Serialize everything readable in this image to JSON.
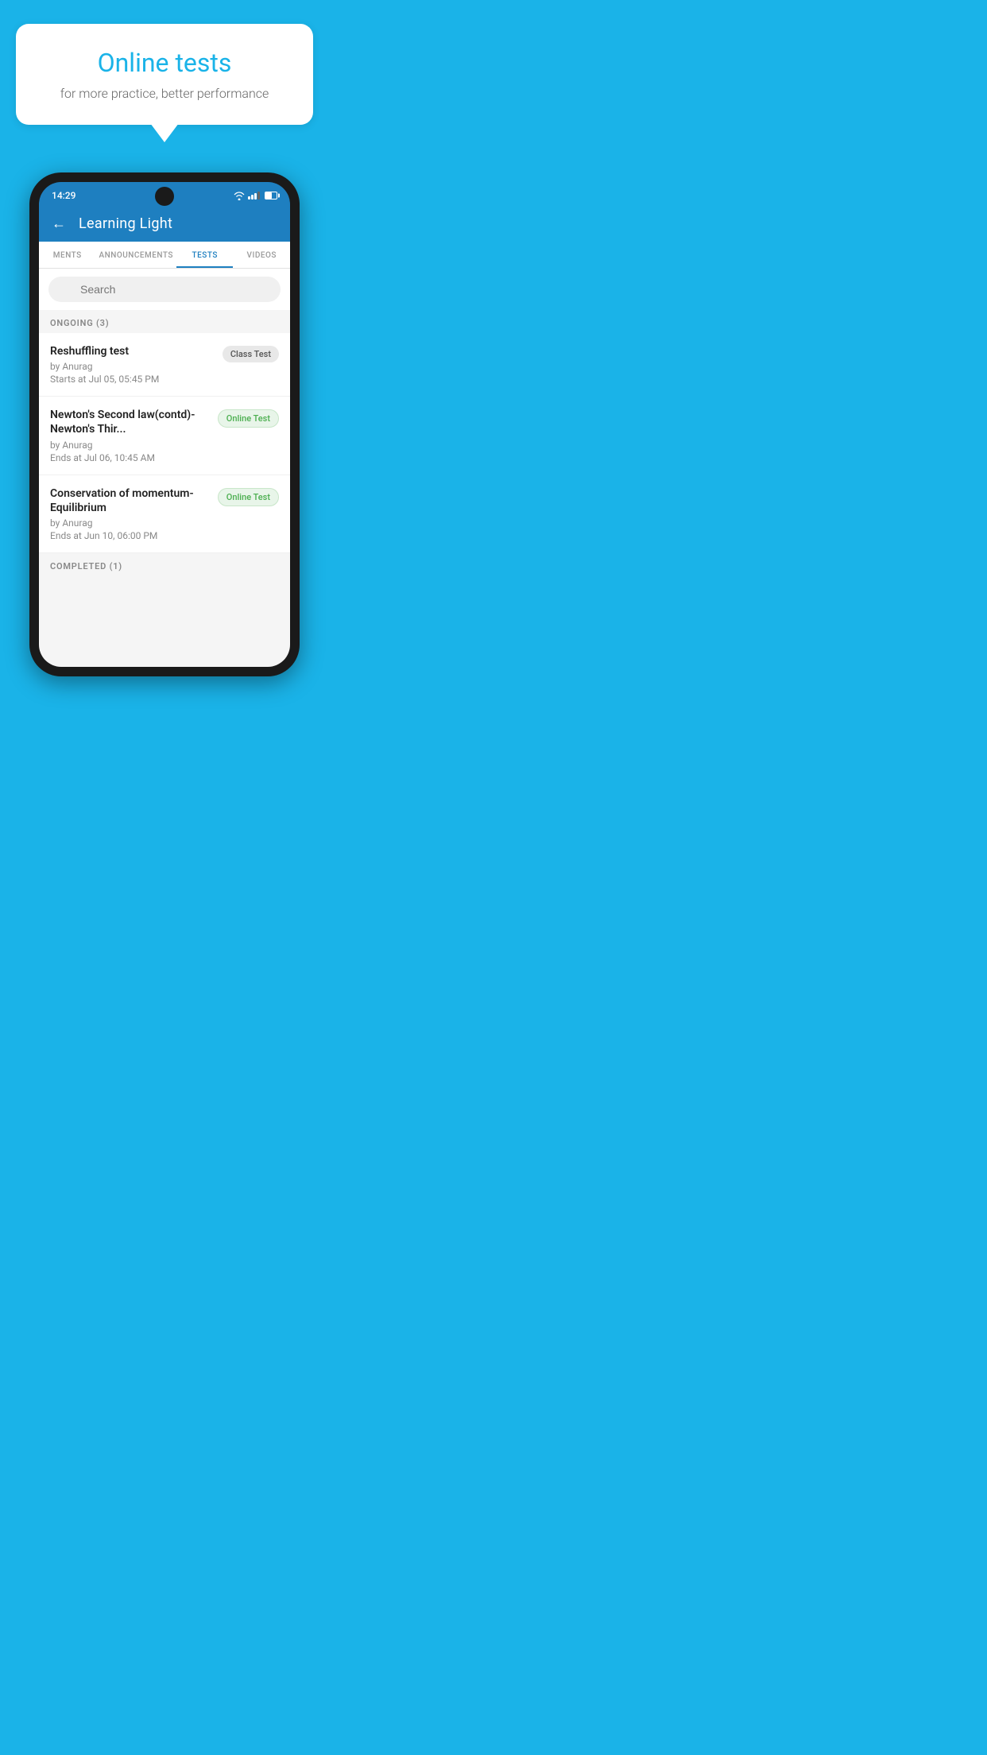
{
  "background_color": "#1ab3e8",
  "speech_bubble": {
    "title": "Online tests",
    "subtitle": "for more practice, better performance"
  },
  "phone": {
    "status_bar": {
      "time": "14:29"
    },
    "app_header": {
      "title": "Learning Light",
      "back_label": "←"
    },
    "tabs": [
      {
        "label": "MENTS",
        "active": false
      },
      {
        "label": "ANNOUNCEMENTS",
        "active": false
      },
      {
        "label": "TESTS",
        "active": true
      },
      {
        "label": "VIDEOS",
        "active": false
      }
    ],
    "search": {
      "placeholder": "Search"
    },
    "ongoing_section": {
      "label": "ONGOING (3)"
    },
    "tests": [
      {
        "name": "Reshuffling test",
        "author": "by Anurag",
        "date": "Starts at  Jul 05, 05:45 PM",
        "badge": "Class Test",
        "badge_type": "class"
      },
      {
        "name": "Newton's Second law(contd)-Newton's Thir...",
        "author": "by Anurag",
        "date": "Ends at  Jul 06, 10:45 AM",
        "badge": "Online Test",
        "badge_type": "online"
      },
      {
        "name": "Conservation of momentum-Equilibrium",
        "author": "by Anurag",
        "date": "Ends at  Jun 10, 06:00 PM",
        "badge": "Online Test",
        "badge_type": "online"
      }
    ],
    "completed_section": {
      "label": "COMPLETED (1)"
    }
  }
}
